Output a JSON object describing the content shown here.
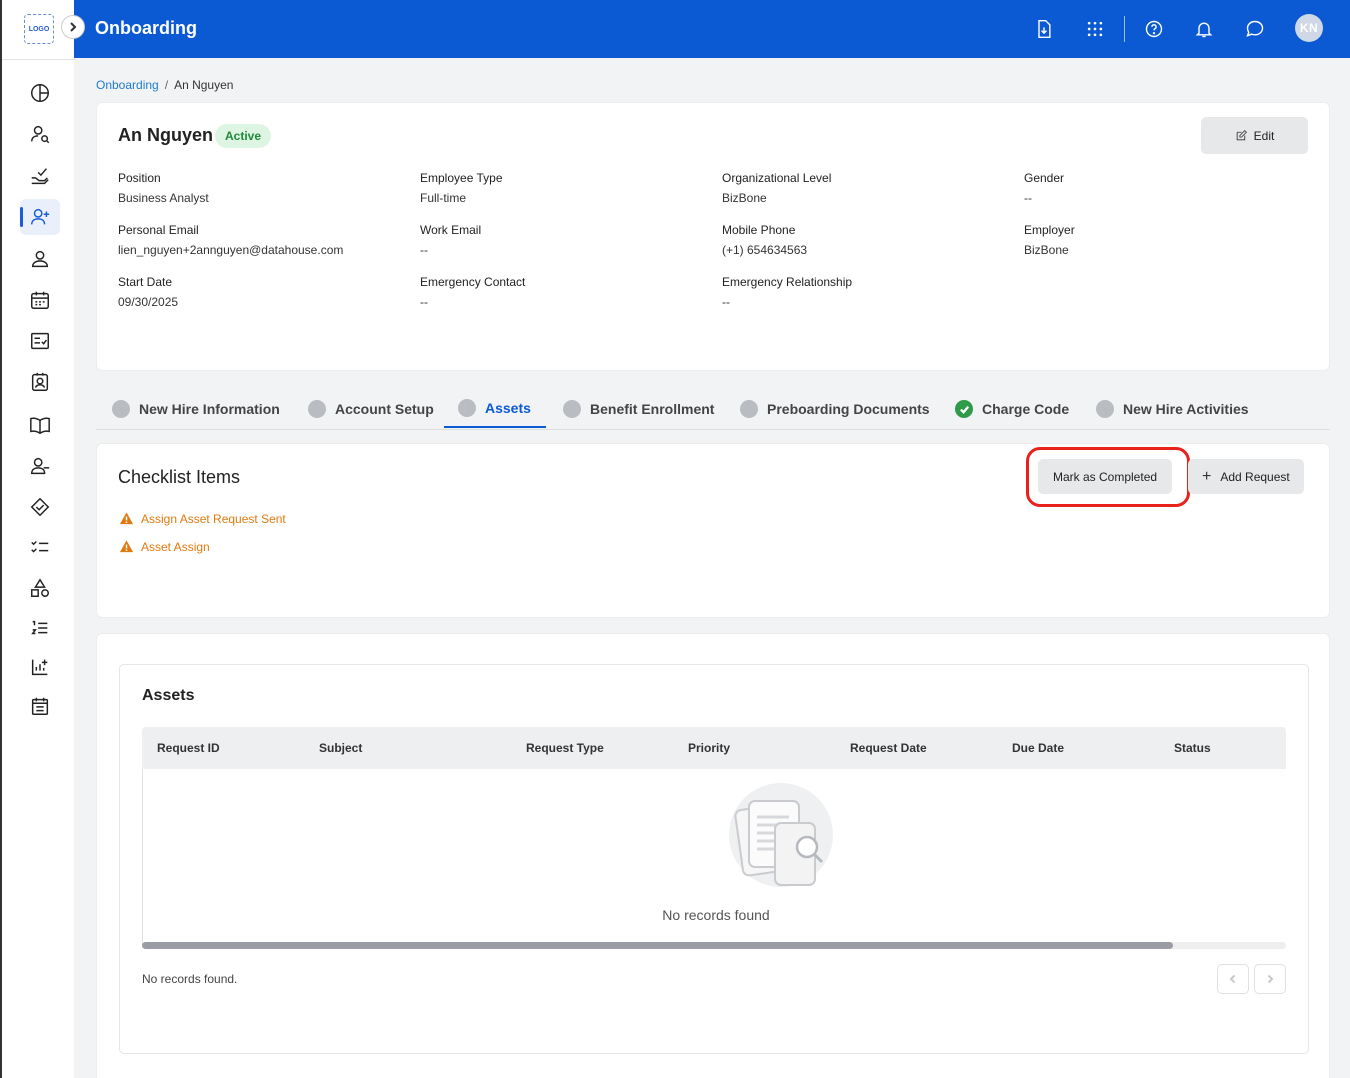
{
  "app": {
    "logo_text": "LOGO",
    "title": "Onboarding",
    "user_initials": "KN",
    "header_icons": [
      "download-doc-icon",
      "apps-grid-icon",
      "help-icon",
      "bell-icon",
      "chat-icon"
    ]
  },
  "sidebar": {
    "items": [
      {
        "icon": "dashboard-icon"
      },
      {
        "icon": "user-search-icon"
      },
      {
        "icon": "hand-check-icon"
      },
      {
        "icon": "user-add-icon",
        "active": true
      },
      {
        "icon": "person-icon"
      },
      {
        "icon": "calendar-icon"
      },
      {
        "icon": "checklist-board-icon"
      },
      {
        "icon": "contact-card-icon"
      },
      {
        "icon": "book-icon"
      },
      {
        "icon": "user-remove-icon"
      },
      {
        "icon": "handshake-icon"
      },
      {
        "icon": "task-list-icon"
      },
      {
        "icon": "shapes-icon"
      },
      {
        "icon": "numbered-list-icon"
      },
      {
        "icon": "report-add-icon"
      },
      {
        "icon": "schedule-icon"
      }
    ]
  },
  "breadcrumb": {
    "parent": "Onboarding",
    "separator": "/",
    "current": "An Nguyen"
  },
  "profile": {
    "name": "An Nguyen",
    "status": "Active",
    "edit_label": "Edit",
    "fields": {
      "position": {
        "label": "Position",
        "value": "Business Analyst"
      },
      "employee_type": {
        "label": "Employee Type",
        "value": "Full-time"
      },
      "org_level": {
        "label": "Organizational Level",
        "value": "BizBone"
      },
      "gender": {
        "label": "Gender",
        "value": "--"
      },
      "personal_email": {
        "label": "Personal Email",
        "value": "lien_nguyen+2annguyen@datahouse.com"
      },
      "work_email": {
        "label": "Work Email",
        "value": "--"
      },
      "mobile_phone": {
        "label": "Mobile Phone",
        "value": "(+1) 654634563"
      },
      "employer": {
        "label": "Employer",
        "value": "BizBone"
      },
      "start_date": {
        "label": "Start Date",
        "value": "09/30/2025"
      },
      "emergency_contact": {
        "label": "Emergency Contact",
        "value": "--"
      },
      "emergency_relationship": {
        "label": "Emergency Relationship",
        "value": "--"
      }
    }
  },
  "tabs": [
    {
      "label": "New Hire Information",
      "state": "pending"
    },
    {
      "label": "Account Setup",
      "state": "pending"
    },
    {
      "label": "Assets",
      "state": "active"
    },
    {
      "label": "Benefit Enrollment",
      "state": "pending"
    },
    {
      "label": "Preboarding Documents",
      "state": "pending"
    },
    {
      "label": "Charge Code",
      "state": "done"
    },
    {
      "label": "New Hire Activities",
      "state": "pending"
    }
  ],
  "checklist": {
    "title": "Checklist Items",
    "mark_completed_label": "Mark as Completed",
    "add_request_label": "Add Request",
    "items": [
      {
        "label": "Assign Asset Request Sent",
        "icon": "warning-icon"
      },
      {
        "label": "Asset Assign",
        "icon": "warning-icon"
      }
    ]
  },
  "assets": {
    "title": "Assets",
    "columns": [
      "Request ID",
      "Subject",
      "Request Type",
      "Priority",
      "Request Date",
      "Due Date",
      "Status"
    ],
    "rows": [],
    "empty_text": "No records found",
    "footer_text": "No records found."
  },
  "colors": {
    "header_bg": "#0b5ad4",
    "accent": "#0b5ad4",
    "warning": "#e07a10",
    "success": "#2e9b4b",
    "highlight": "#e8211b"
  }
}
